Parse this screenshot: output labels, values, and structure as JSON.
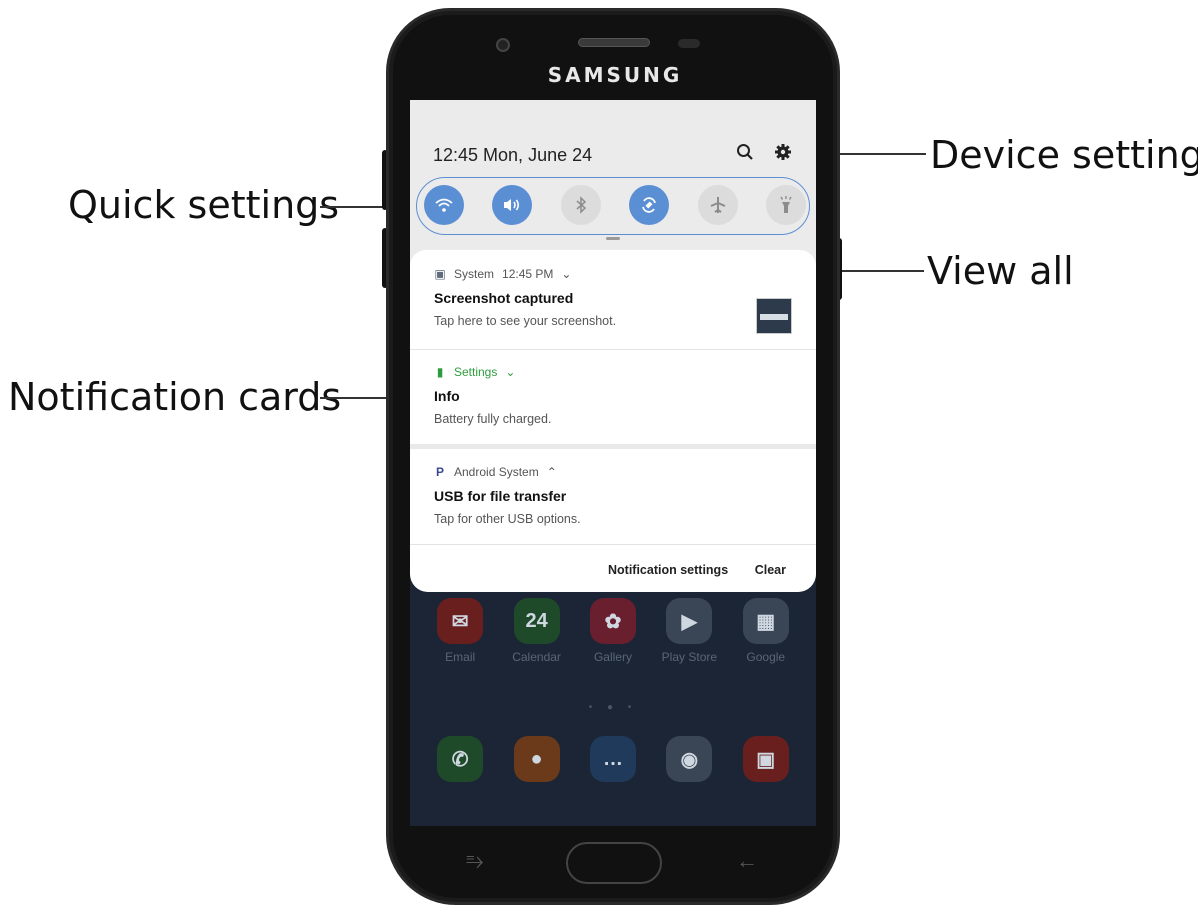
{
  "callouts": {
    "quick_settings": "Quick settings",
    "notification_cards": "Notification cards",
    "device_settings": "Device settings",
    "view_all": "View all"
  },
  "device": {
    "brand": "SAMSUNG"
  },
  "status": {
    "time_date": "12:45  Mon, June 24"
  },
  "top_icons": {
    "search": "search-icon",
    "settings": "gear-icon"
  },
  "quick_settings": [
    {
      "name": "wifi",
      "icon": "ᯤ",
      "state": "on"
    },
    {
      "name": "sound",
      "icon": "◀)",
      "state": "on"
    },
    {
      "name": "bluetooth",
      "icon": "∦",
      "state": "off"
    },
    {
      "name": "auto-rotate",
      "icon": "⟲",
      "state": "on"
    },
    {
      "name": "airplane",
      "icon": "✈",
      "state": "off"
    },
    {
      "name": "flashlight",
      "icon": "♆",
      "state": "off"
    }
  ],
  "notifications": [
    {
      "app": "System",
      "time": "12:45 PM",
      "chevron": "⌄",
      "title": "Screenshot captured",
      "body": "Tap here to see your screenshot.",
      "icon": "▣",
      "icon_color": "#5d6b7a"
    },
    {
      "app": "Settings",
      "time": "",
      "chevron": "⌄",
      "title": "Info",
      "body": "Battery fully charged.",
      "icon": "▮",
      "icon_color": "#2e9c3e"
    },
    {
      "app": "Android System",
      "time": "",
      "chevron": "⌃",
      "title": "USB for file transfer",
      "body": "Tap for other USB options.",
      "icon": "P",
      "icon_color": "#3b4a8c"
    }
  ],
  "footer": {
    "notification_settings": "Notification settings",
    "clear": "Clear"
  },
  "home": {
    "row1": [
      {
        "label": "Email",
        "glyph": "✉",
        "color": "#6a1f1f"
      },
      {
        "label": "Calendar",
        "glyph": "24",
        "color": "#1f4a2a"
      },
      {
        "label": "Gallery",
        "glyph": "✿",
        "color": "#6a1f2f"
      },
      {
        "label": "Play Store",
        "glyph": "▶",
        "color": "#3a4656"
      },
      {
        "label": "Google",
        "glyph": "▦",
        "color": "#3a4656"
      }
    ],
    "row2": [
      {
        "label": "",
        "glyph": "✆",
        "color": "#1f4a2a"
      },
      {
        "label": "",
        "glyph": "●",
        "color": "#6a3a1a"
      },
      {
        "label": "",
        "glyph": "…",
        "color": "#1f3a5a"
      },
      {
        "label": "",
        "glyph": "◉",
        "color": "#3a4656"
      },
      {
        "label": "",
        "glyph": "▣",
        "color": "#6a1f1f"
      }
    ],
    "page_dots": "• ● •"
  },
  "softkeys": {
    "recents": "⥱",
    "back": "←"
  }
}
